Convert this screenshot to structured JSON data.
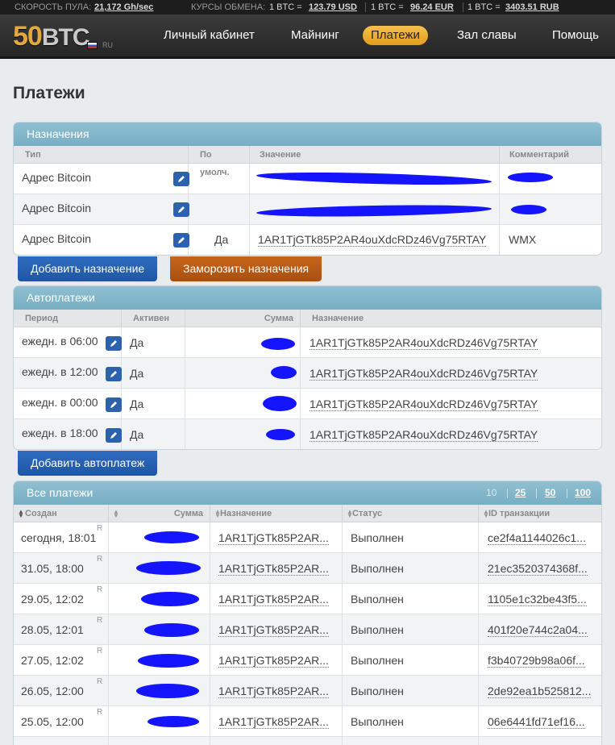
{
  "stats": {
    "pool_speed_label": "СКОРОСТЬ ПУЛА:",
    "pool_speed": "21,172 Gh/sec",
    "rates_label": "КУРСЫ ОБМЕНА:",
    "rates": [
      {
        "label": "1 BTC =",
        "value": "123.79 USD"
      },
      {
        "label": "1 BTC =",
        "value": "96.24 EUR"
      },
      {
        "label": "1 BTC =",
        "value": "3403.51 RUB"
      }
    ]
  },
  "header": {
    "logo_num": "50",
    "logo_btc": "BTC",
    "locale": "RU",
    "nav": [
      "Личный кабинет",
      "Майнинг",
      "Платежи",
      "Зал славы",
      "Помощь"
    ],
    "active_nav": "Платежи"
  },
  "page_title": "Платежи",
  "destinations": {
    "title": "Назначения",
    "columns": [
      "Тип",
      "По умолч.",
      "Значение",
      "Комментарий"
    ],
    "rows": [
      {
        "type": "Адрес Bitcoin",
        "default": "",
        "value": "",
        "comment": ""
      },
      {
        "type": "Адрес Bitcoin",
        "default": "",
        "value": "",
        "comment": ""
      },
      {
        "type": "Адрес Bitcoin",
        "default": "Да",
        "value": "1AR1TjGTk85P2AR4ouXdcRDz46Vg75RTAY",
        "comment": "WMX"
      }
    ],
    "add_button": "Добавить назначение",
    "freeze_button": "Заморозить назначения"
  },
  "autopayments": {
    "title": "Автоплатежи",
    "columns": [
      "Период",
      "Активен",
      "Сумма",
      "Назначение"
    ],
    "rows": [
      {
        "period": "ежедн. в 06:00",
        "active": "Да",
        "destination": "1AR1TjGTk85P2AR4ouXdcRDz46Vg75RTAY"
      },
      {
        "period": "ежедн. в 12:00",
        "active": "Да",
        "destination": "1AR1TjGTk85P2AR4ouXdcRDz46Vg75RTAY"
      },
      {
        "period": "ежедн. в 00:00",
        "active": "Да",
        "destination": "1AR1TjGTk85P2AR4ouXdcRDz46Vg75RTAY"
      },
      {
        "period": "ежедн. в 18:00",
        "active": "Да",
        "destination": "1AR1TjGTk85P2AR4ouXdcRDz46Vg75RTAY"
      }
    ],
    "add_button": "Добавить автоплатеж"
  },
  "payments": {
    "title": "Все платежи",
    "page_sizes": [
      "10",
      "25",
      "50",
      "100"
    ],
    "current_page_size": "10",
    "columns": [
      "Создан",
      "Сумма",
      "Назначение",
      "Статус",
      "ID транзакции"
    ],
    "rows": [
      {
        "created": "сегодня, 18:01",
        "flag": "R",
        "destination": "1AR1TjGTk85P2AR...",
        "status": "Выполнен",
        "txid": "ce2f4a1144026c1..."
      },
      {
        "created": "31.05, 18:00",
        "flag": "R",
        "destination": "1AR1TjGTk85P2AR...",
        "status": "Выполнен",
        "txid": "21ec3520374368f..."
      },
      {
        "created": "29.05, 12:02",
        "flag": "R",
        "destination": "1AR1TjGTk85P2AR...",
        "status": "Выполнен",
        "txid": "1105e1c32be43f5..."
      },
      {
        "created": "28.05, 12:01",
        "flag": "R",
        "destination": "1AR1TjGTk85P2AR...",
        "status": "Выполнен",
        "txid": "401f20e744c2a04..."
      },
      {
        "created": "27.05, 12:02",
        "flag": "R",
        "destination": "1AR1TjGTk85P2AR...",
        "status": "Выполнен",
        "txid": "f3b40729b98a06f..."
      },
      {
        "created": "26.05, 12:00",
        "flag": "R",
        "destination": "1AR1TjGTk85P2AR...",
        "status": "Выполнен",
        "txid": "2de92ea1b525812..."
      },
      {
        "created": "25.05, 12:00",
        "flag": "R",
        "destination": "1AR1TjGTk85P2AR...",
        "status": "Выполнен",
        "txid": "06e6441fd71ef16..."
      }
    ]
  },
  "colors": {
    "accent": "#e4a83c",
    "panel_head": "#7fb3c7",
    "button_blue": "#2459a8",
    "button_orange": "#b8581a",
    "redaction": "#1414ff"
  }
}
